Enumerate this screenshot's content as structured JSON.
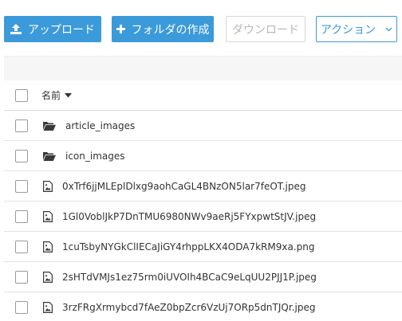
{
  "toolbar": {
    "upload_label": "アップロード",
    "create_folder_label": "フォルダの作成",
    "download_label": "ダウンロード",
    "actions_label": "アクション"
  },
  "table": {
    "header_name": "名前",
    "folders": [
      {
        "name": "article_images"
      },
      {
        "name": "icon_images"
      }
    ],
    "files": [
      {
        "name": "0xTrf6jjMLEplDlxg9aohCaGL4BNzON5lar7feOT.jpeg"
      },
      {
        "name": "1Gl0VoblJkP7DnTMU6980NWv9aeRj5FYxpwtStJV.jpeg"
      },
      {
        "name": "1cuTsbyNYGkClIECaJiGY4rhppLKX4ODA7kRM9xa.png"
      },
      {
        "name": "2sHTdVMJs1ez75rm0iUVOIh4BCaC9eLqUU2PJJ1P.jpeg"
      },
      {
        "name": "3rzFRgXrmybcd7fAeZ0bpZcr6VzUj7ORp5dnTJQr.jpeg"
      }
    ]
  },
  "colors": {
    "primary": "#3b9ad9",
    "disabled_text": "#b8b8b8",
    "band": "#f6f6f6"
  },
  "icons": {
    "upload": "upload-icon",
    "add": "plus-icon",
    "folder": "folder-open-icon",
    "file": "image-file-icon",
    "chevron": "chevron-down-icon",
    "sort": "caret-down-icon"
  }
}
